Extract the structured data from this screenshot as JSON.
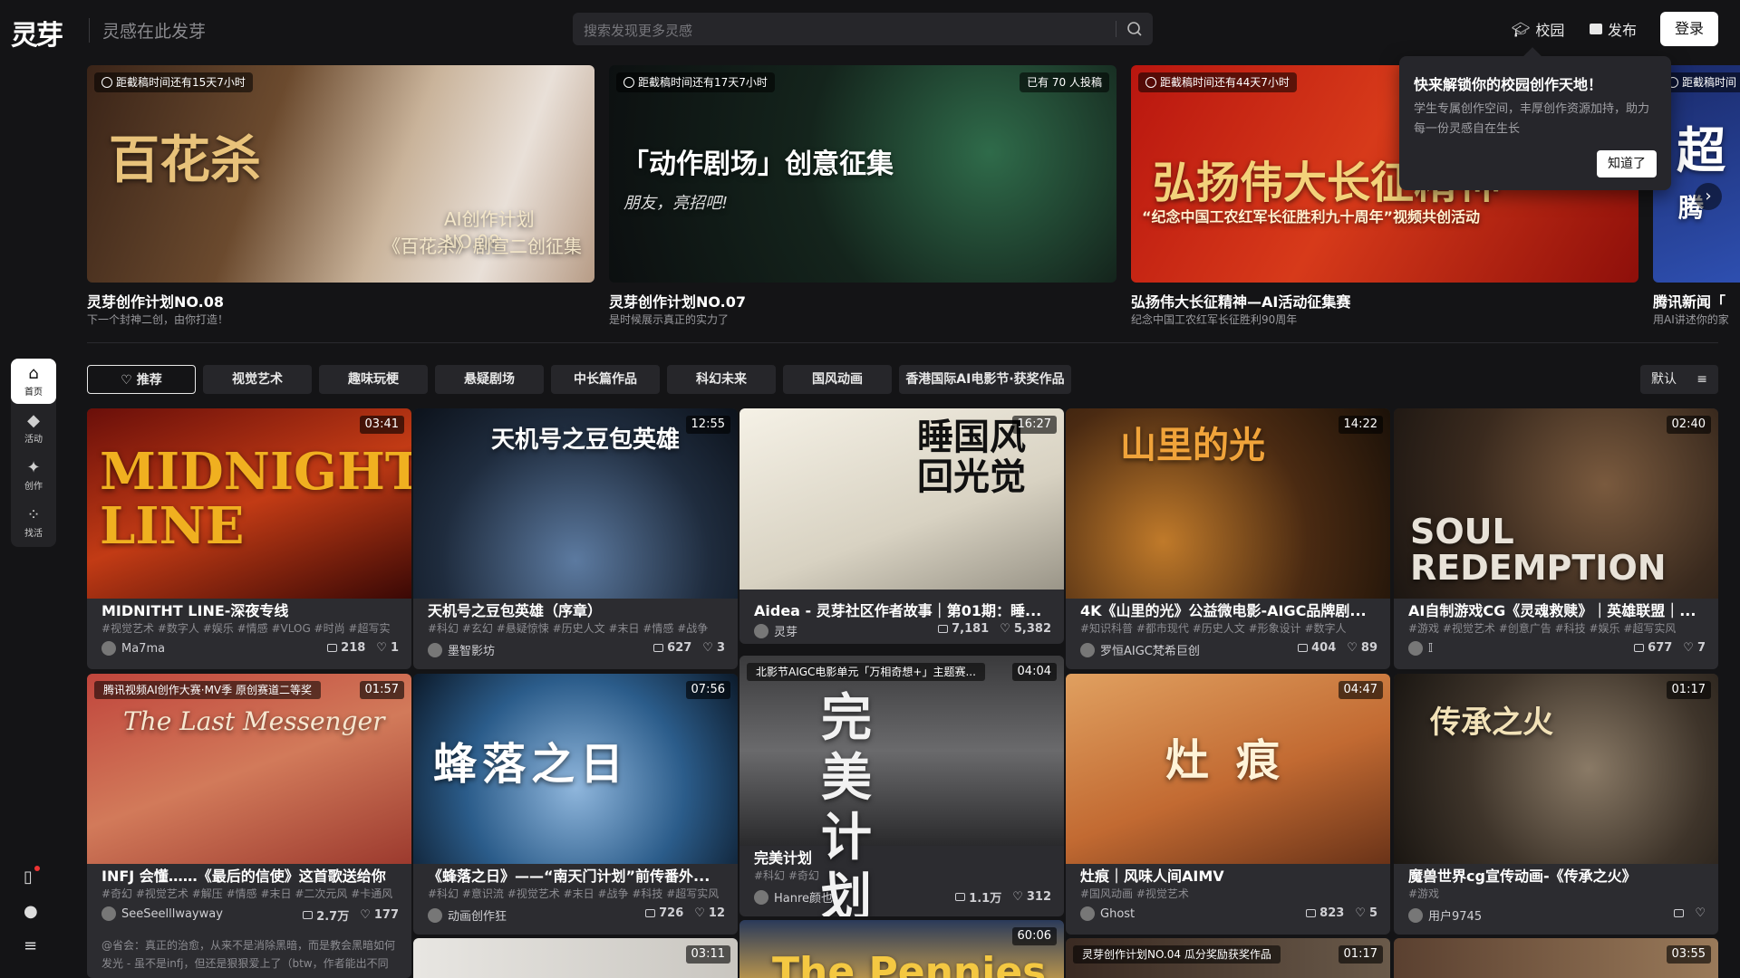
{
  "header": {
    "logo": "灵芽",
    "slogan": "灵感在此发芽",
    "search_placeholder": "搜索发现更多灵感",
    "campus": "校园",
    "publish": "发布",
    "login": "登录"
  },
  "sidenav": {
    "items": [
      {
        "label": "首页",
        "icon": "home-icon"
      },
      {
        "label": "活动",
        "icon": "activity-icon"
      },
      {
        "label": "创作",
        "icon": "create-icon"
      },
      {
        "label": "找活",
        "icon": "jobs-icon"
      }
    ]
  },
  "banners": [
    {
      "time": "距截稿时间还有15天7小时",
      "title": "灵芽创作计划NO.08",
      "sub": "下一个封神二创，由你打造！",
      "line1": "AI创作计划 NO.08",
      "line2": "《百花杀》剧宣二创征集",
      "art": "百花杀",
      "count": ""
    },
    {
      "time": "距截稿时间还有17天7小时",
      "title": "灵芽创作计划NO.07",
      "sub": "是时候展示真正的实力了",
      "line1": "「动作剧场」创意征集",
      "line2": "朋友，亮招吧!",
      "count": "已有 70 人投稿"
    },
    {
      "time": "距截稿时间还有44天7小时",
      "title": "弘扬伟大长征精神—AI活动征集赛",
      "sub": "纪念中国工农红军长征胜利90周年",
      "line1": "弘扬伟大长征精神",
      "line2": "“纪念中国工农红军长征胜利九十周年”视频共创活动",
      "count": ""
    },
    {
      "time": "距截稿时间",
      "title": "腾讯新闻「",
      "sub": "用AI讲述你的家",
      "line1": "超",
      "line2": "腾",
      "count": ""
    }
  ],
  "popup": {
    "title": "快来解锁你的校园创作天地！",
    "desc": "学生专属创作空间，丰厚创作资源加持，助力每一份灵感自在生长",
    "button": "知道了"
  },
  "tabs": [
    "推荐",
    "视觉艺术",
    "趣味玩梗",
    "悬疑剧场",
    "中长篇作品",
    "科幻未来",
    "国风动画",
    "香港国际AI电影节·获奖作品"
  ],
  "sort": "默认",
  "cards": [
    {
      "title": "MIDNITHT LINE-深夜专线",
      "tags": "#视觉艺术 #数字人 #娱乐 #情感 #VLOG #时尚 #超写实",
      "user": "Ma7ma",
      "views": "218",
      "likes": "1",
      "duration": "03:41",
      "art": "MIDNIGHT LINE",
      "chip": ""
    },
    {
      "title": "天机号之豆包英雄（序章）",
      "tags": "#科幻 #玄幻 #悬疑惊悚 #历史人文 #末日 #情感 #战争",
      "user": "墨智影坊",
      "views": "627",
      "likes": "3",
      "duration": "12:55",
      "art": "天机号之豆包英雄",
      "chip": ""
    },
    {
      "title": "Aidea - 灵芽社区作者故事｜第01期：睡...",
      "tags": "",
      "user": "灵芽",
      "views": "7,181",
      "likes": "5,382",
      "duration": "16:27",
      "art": "睡国风回光觉",
      "chip": ""
    },
    {
      "title": "4K《山里的光》公益微电影-AIGC品牌剧...",
      "tags": "#知识科普 #都市现代 #历史人文 #形象设计 #数字人",
      "user": "罗恒AIGC梵希巨创",
      "views": "404",
      "likes": "89",
      "duration": "14:22",
      "art": "山里的光",
      "chip": ""
    },
    {
      "title": "AI自制游戏CG《灵魂救赎》｜英雄联盟｜...",
      "tags": "#游戏 #视觉艺术 #创意广告 #科技 #娱乐 #超写实风",
      "user": "𝕀",
      "views": "677",
      "likes": "7",
      "duration": "02:40",
      "art": "SOUL REDEMPTION",
      "chip": ""
    },
    {
      "title": "INFJ 会懂……《最后的信使》这首歌送给你",
      "tags": "#奇幻 #视觉艺术 #解压 #情感 #末日 #二次元风 #卡通风",
      "user": "SeeSeelllwayway",
      "views": "2.7万",
      "likes": "177",
      "duration": "01:57",
      "art": "The Last Messenger",
      "chip": "腾讯视频AI创作大赛·MV季 原创赛道二等奖",
      "comment": "@省会：真正的治愈，从来不是消除黑暗，而是教会黑暗如何发光 - 虽不是infj，但还是狠狠爱上了（btw，作者能出不同"
    },
    {
      "title": "《蜂落之日》——“南天门计划”前传番外...",
      "tags": "#科幻 #意识流 #视觉艺术 #末日 #战争 #科技 #超写实风",
      "user": "动画创作狂",
      "views": "726",
      "likes": "12",
      "duration": "07:56",
      "art": "蜂落之日",
      "chip": ""
    },
    {
      "title": "完美计划",
      "tags": "#科幻 #奇幻",
      "user": "Hanre颜也",
      "views": "1.1万",
      "likes": "312",
      "duration": "04:04",
      "art": "完美计划",
      "chip": "北影节AIGC电影单元「万相奇想+」主题赛..."
    },
    {
      "title": "灶痕｜风味人间AIMV",
      "tags": "#国风动画 #视觉艺术",
      "user": "Ghost",
      "views": "823",
      "likes": "5",
      "duration": "04:47",
      "art": "灶痕",
      "chip": ""
    },
    {
      "title": "魔兽世界cg宣传动画-《传承之火》",
      "tags": "#游戏",
      "user": "用户9745",
      "views": "",
      "likes": "",
      "duration": "01:17",
      "art": "传承之火",
      "chip": ""
    },
    {
      "title": "",
      "tags": "",
      "user": "",
      "views": "",
      "likes": "",
      "duration": "03:11",
      "art": "",
      "chip": ""
    },
    {
      "title": "",
      "tags": "",
      "user": "",
      "views": "",
      "likes": "",
      "duration": "60:06",
      "art": "The Pennies",
      "chip": ""
    },
    {
      "title": "",
      "tags": "",
      "user": "",
      "views": "",
      "likes": "",
      "duration": "01:17",
      "art": "",
      "chip": "灵芽创作计划NO.04 瓜分奖励获奖作品"
    },
    {
      "title": "",
      "tags": "",
      "user": "",
      "views": "",
      "likes": "",
      "duration": "03:55",
      "art": "",
      "chip": ""
    }
  ],
  "colors": {
    "bg": "#141416",
    "card": "#2c2c30",
    "accent": "#ffffff"
  }
}
